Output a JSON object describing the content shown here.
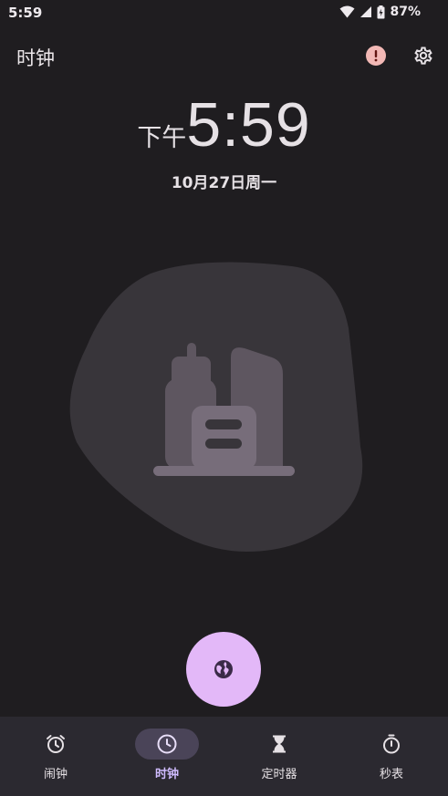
{
  "status_bar": {
    "time": "5:59",
    "battery_percent": "87%",
    "icons": [
      "wifi-icon",
      "signal-icon",
      "battery-icon"
    ]
  },
  "app_bar": {
    "title": "时钟",
    "actions": [
      "alert-icon",
      "gear-icon"
    ]
  },
  "clock": {
    "ampm": "下午",
    "time": "5:59",
    "date": "10月27日周一"
  },
  "illustration": {
    "icon": "city-buildings-icon"
  },
  "fab": {
    "icon": "globe-icon"
  },
  "bottom_nav": {
    "items": [
      {
        "label": "闹钟",
        "icon": "alarm-icon",
        "active": false
      },
      {
        "label": "时钟",
        "icon": "clock-icon",
        "active": true
      },
      {
        "label": "定时器",
        "icon": "hourglass-icon",
        "active": false
      },
      {
        "label": "秒表",
        "icon": "stopwatch-icon",
        "active": false
      }
    ]
  },
  "colors": {
    "background": "#1f1d20",
    "nav_background": "#2b2930",
    "fab": "#e3b8f8",
    "active_indicator": "#4a4458",
    "active_label": "#d0bcff",
    "alert": "#f2b8b5"
  }
}
